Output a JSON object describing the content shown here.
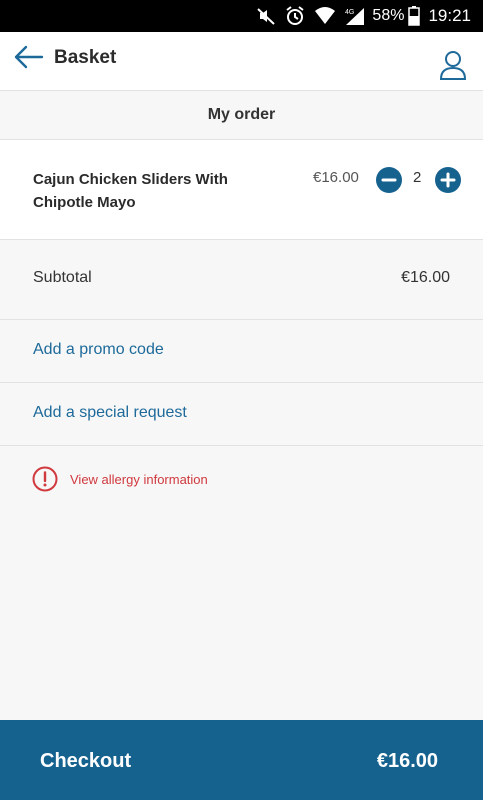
{
  "status_bar": {
    "battery": "58%",
    "time": "19:21",
    "network": "4G",
    "icons": [
      "mute-icon",
      "alarm-icon",
      "wifi-icon",
      "signal-icon",
      "battery-icon"
    ]
  },
  "header": {
    "title": "Basket",
    "back_icon": "arrow-left-icon",
    "account_icon": "user-icon"
  },
  "order": {
    "section_title": "My order",
    "items": [
      {
        "name": "Cajun Chicken Sliders With Chipotle Mayo",
        "price": "€16.00",
        "quantity": "2"
      }
    ]
  },
  "summary": {
    "subtotal_label": "Subtotal",
    "subtotal_value": "€16.00"
  },
  "actions": {
    "promo_code": "Add a promo code",
    "special_request": "Add a special request",
    "allergy_info": "View allergy information"
  },
  "checkout": {
    "label": "Checkout",
    "total": "€16.00"
  },
  "colors": {
    "accent": "#16628f",
    "link": "#1d6a9a",
    "warning": "#d0393e",
    "background": "#f7f7f7"
  }
}
